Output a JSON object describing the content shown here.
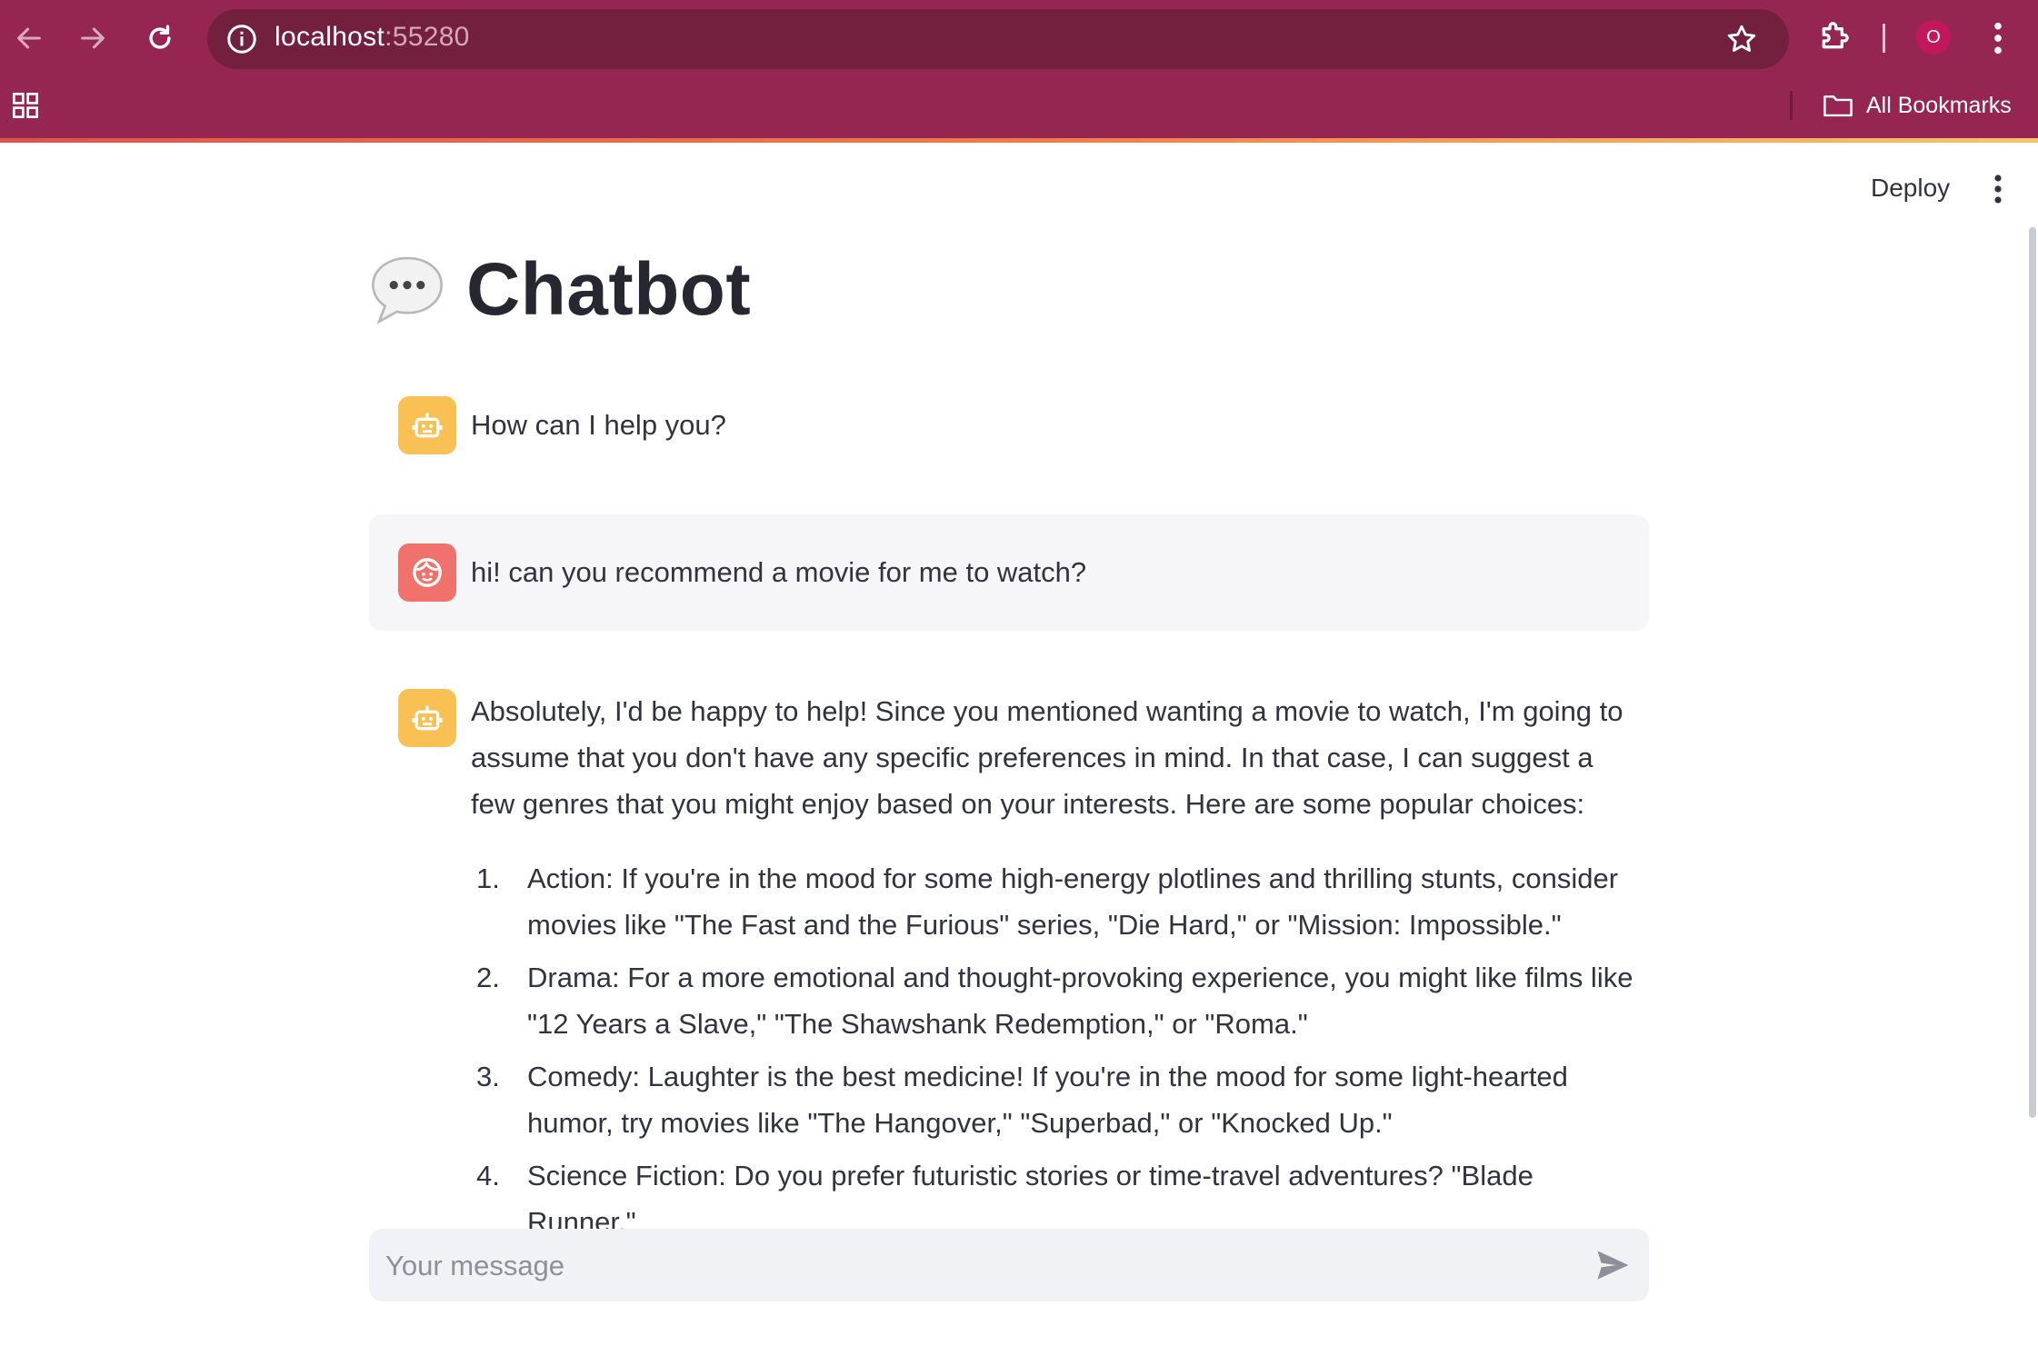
{
  "browser": {
    "url_host": "localhost",
    "url_port": ":55280",
    "profile_initial": "O",
    "bookmarks_label": "All Bookmarks",
    "colors": {
      "toolbar": "#952652",
      "url_bar": "#73203f"
    },
    "icons": [
      "back-arrow-icon",
      "forward-arrow-icon",
      "reload-icon",
      "info-icon",
      "star-icon",
      "extensions-icon",
      "kebab-menu-icon",
      "apps-grid-icon",
      "folder-icon"
    ]
  },
  "app": {
    "deploy_label": "Deploy",
    "title": "Chatbot",
    "title_emoji": "speech-balloon-icon",
    "messages": [
      {
        "role": "assistant",
        "text": "How can I help you?"
      },
      {
        "role": "user",
        "text": "hi! can you recommend a movie for me to watch?"
      },
      {
        "role": "assistant",
        "intro": "Absolutely, I'd be happy to help! Since you mentioned wanting a movie to watch, I'm going to assume that you don't have any specific preferences in mind. In that case, I can suggest a few genres that you might enjoy based on your interests. Here are some popular choices:",
        "list": [
          {
            "num": "1.",
            "text": "Action: If you're in the mood for some high-energy plotlines and thrilling stunts, consider movies like \"The Fast and the Furious\" series, \"Die Hard,\" or \"Mission: Impossible.\""
          },
          {
            "num": "2.",
            "text": "Drama: For a more emotional and thought-provoking experience, you might like films like \"12 Years a Slave,\" \"The Shawshank Redemption,\" or \"Roma.\""
          },
          {
            "num": "3.",
            "text": "Comedy: Laughter is the best medicine! If you're in the mood for some light-hearted humor, try movies like \"The Hangover,\" \"Superbad,\" or \"Knocked Up.\""
          },
          {
            "num": "4.",
            "text": "Science Fiction: Do you prefer futuristic stories or time-travel adventures? \"Blade Runner,\""
          }
        ]
      }
    ],
    "input": {
      "placeholder": "Your message",
      "value": ""
    },
    "colors": {
      "bot_avatar": "#f9c154",
      "user_avatar": "#f1716c",
      "user_bubble": "#f6f6f8",
      "text": "#31333f"
    }
  }
}
